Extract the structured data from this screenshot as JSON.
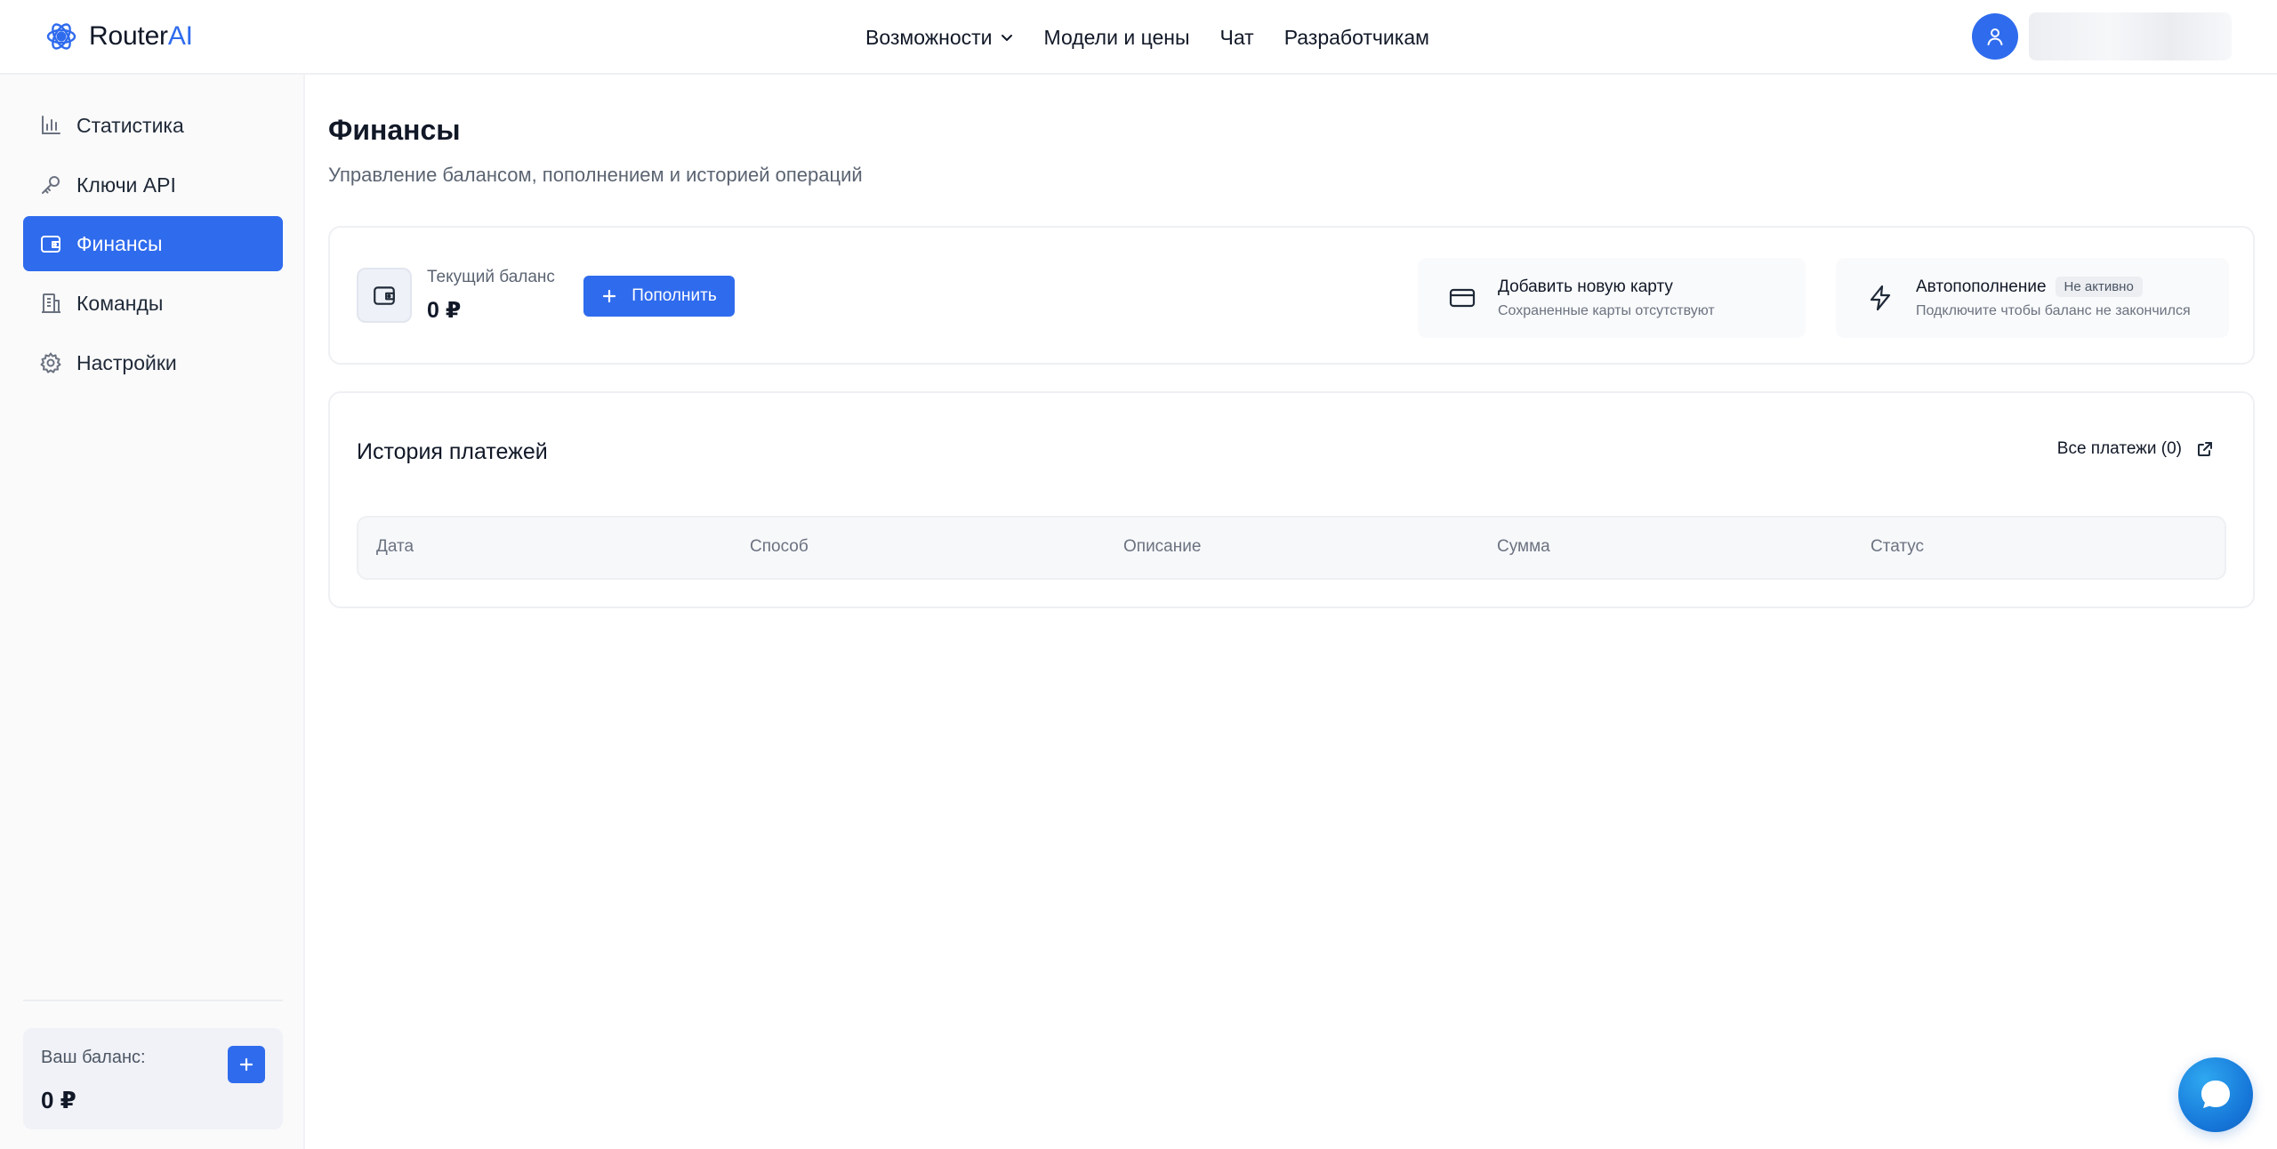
{
  "brand": {
    "name_part1": "Router",
    "name_part2": "AI",
    "accent": "#2f6bed"
  },
  "nav": {
    "features": "Возможности",
    "models": "Модели и цены",
    "chat": "Чат",
    "developers": "Разработчикам"
  },
  "sidebar": {
    "items": [
      {
        "label": "Статистика",
        "icon": "bar-chart-icon"
      },
      {
        "label": "Ключи API",
        "icon": "key-icon"
      },
      {
        "label": "Финансы",
        "icon": "wallet-icon",
        "active": true
      },
      {
        "label": "Команды",
        "icon": "building-icon"
      },
      {
        "label": "Настройки",
        "icon": "gear-icon"
      }
    ],
    "balance_label": "Ваш баланс:",
    "balance_value": "0 ₽"
  },
  "page": {
    "title": "Финансы",
    "subtitle": "Управление балансом, пополнением и историей операций"
  },
  "balance": {
    "label": "Текущий баланс",
    "value": "0 ₽",
    "topup_label": "Пополнить"
  },
  "card": {
    "title": "Добавить новую карту",
    "subtitle": "Сохраненные карты отсутствуют"
  },
  "autopay": {
    "title": "Автопополнение",
    "status": "Не активно",
    "subtitle": "Подключите чтобы баланс не закончился"
  },
  "history": {
    "title": "История платежей",
    "all_link": "Все платежи (0)",
    "columns": [
      "Дата",
      "Способ",
      "Описание",
      "Сумма",
      "Статус"
    ]
  }
}
